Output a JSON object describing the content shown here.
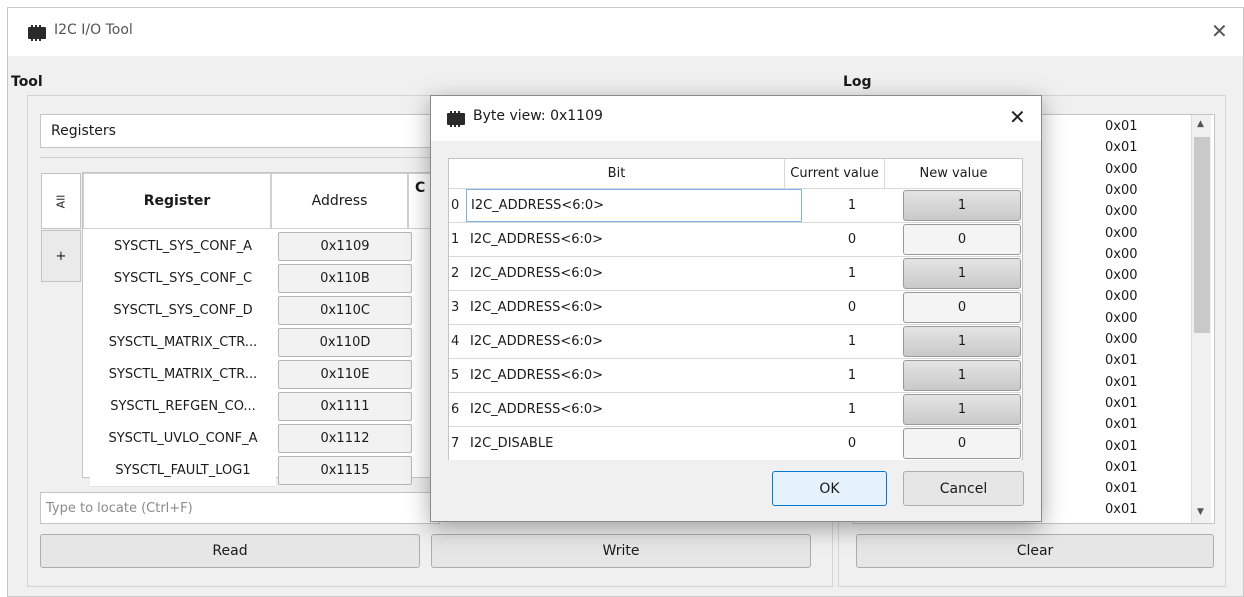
{
  "window": {
    "title": "I2C I/O Tool",
    "close_glyph": "✕"
  },
  "tool": {
    "group_label": "Tool",
    "mode_value": "Registers",
    "side_tabs": {
      "all_label": "All",
      "add_label": "+"
    },
    "columns": {
      "register": "Register",
      "address": "Address",
      "partial": "C"
    },
    "registers": [
      {
        "name": "SYSCTL_SYS_CONF_A",
        "address": "0x1109"
      },
      {
        "name": "SYSCTL_SYS_CONF_C",
        "address": "0x110B"
      },
      {
        "name": "SYSCTL_SYS_CONF_D",
        "address": "0x110C"
      },
      {
        "name": "SYSCTL_MATRIX_CTR...",
        "address": "0x110D"
      },
      {
        "name": "SYSCTL_MATRIX_CTR...",
        "address": "0x110E"
      },
      {
        "name": "SYSCTL_REFGEN_CO...",
        "address": "0x1111"
      },
      {
        "name": "SYSCTL_UVLO_CONF_A",
        "address": "0x1112"
      },
      {
        "name": "SYSCTL_FAULT_LOG1",
        "address": "0x1115"
      }
    ],
    "search_placeholder": "Type to locate (Ctrl+F)",
    "read_label": "Read",
    "write_label": "Write"
  },
  "log": {
    "group_label": "Log",
    "entries": [
      "0x01",
      "0x01",
      "0x00",
      "0x00",
      "0x00",
      "0x00",
      "0x00",
      "0x00",
      "0x00",
      "0x00",
      "0x00",
      "0x01",
      "0x01",
      "0x01",
      "0x01",
      "0x01",
      "0x01",
      "0x01",
      "0x01"
    ],
    "clear_label": "Clear"
  },
  "dialog": {
    "title": "Byte view: 0x1109",
    "close_glyph": "✕",
    "columns": {
      "bit": "Bit",
      "current": "Current value",
      "new": "New value"
    },
    "bits": [
      {
        "index": "0",
        "name": "I2C_ADDRESS<6:0>",
        "current": "1",
        "new": "1"
      },
      {
        "index": "1",
        "name": "I2C_ADDRESS<6:0>",
        "current": "0",
        "new": "0"
      },
      {
        "index": "2",
        "name": "I2C_ADDRESS<6:0>",
        "current": "1",
        "new": "1"
      },
      {
        "index": "3",
        "name": "I2C_ADDRESS<6:0>",
        "current": "0",
        "new": "0"
      },
      {
        "index": "4",
        "name": "I2C_ADDRESS<6:0>",
        "current": "1",
        "new": "1"
      },
      {
        "index": "5",
        "name": "I2C_ADDRESS<6:0>",
        "current": "1",
        "new": "1"
      },
      {
        "index": "6",
        "name": "I2C_ADDRESS<6:0>",
        "current": "1",
        "new": "1"
      },
      {
        "index": "7",
        "name": "I2C_DISABLE",
        "current": "0",
        "new": "0"
      }
    ],
    "ok_label": "OK",
    "cancel_label": "Cancel"
  },
  "colors": {
    "focus_accent": "#0078d7",
    "window_bg": "#f0f0f0"
  }
}
